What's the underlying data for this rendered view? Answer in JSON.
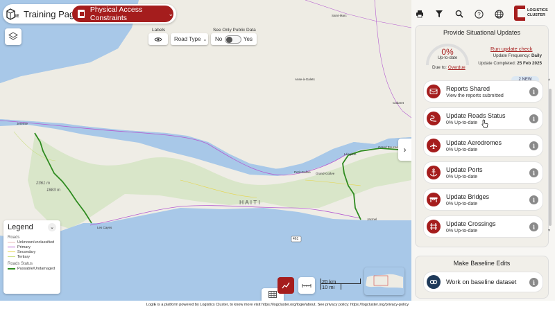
{
  "header": {
    "page_title": "Training Page",
    "context_label": "Physical Access Constraints"
  },
  "map_controls": {
    "labels_title": "Labels",
    "road_type_label": "Road Type",
    "public_data_title": "See Only Public Data",
    "public_no": "No",
    "public_yes": "Yes"
  },
  "map_labels": {
    "haiti": "HAITI",
    "elev_1": "2361 m",
    "elev_2": "1883 m",
    "route_number": "461",
    "towns": [
      "Jeremie",
      "Les Cayes",
      "Jacmel",
      "Saint-Marc",
      "Anse-à-Galets",
      "Cabaret",
      "Petit-Goâve",
      "Grand-Goâve",
      "Léogâne",
      "Grand Boucan"
    ]
  },
  "legend": {
    "title": "Legend",
    "roads_title": "Roads",
    "roads": [
      {
        "label": "Unknown/unclassified",
        "color": "#e8b6b6"
      },
      {
        "label": "Primary",
        "color": "#b45bd0"
      },
      {
        "label": "Secondary",
        "color": "#e6d54a"
      },
      {
        "label": "Tertiary",
        "color": "#c8dc7a"
      }
    ],
    "status_title": "Roads Status",
    "status": [
      {
        "label": "Passable/Undamaged",
        "color": "#2e8b1f"
      }
    ]
  },
  "scale": {
    "top": "20 km",
    "bottom": "10 mi"
  },
  "footer": "LogIE is a platform powered by Logistics Cluster, to know more visit https://logcluster.org/logie/about. See privacy policy: https://logcluster.org/privacy-policy",
  "brand": {
    "line1": "LOGISTICS",
    "line2": "CLUSTER"
  },
  "updates": {
    "title": "Provide Situational Updates",
    "percent": "0%",
    "status": "Up-to-date",
    "due_label": "Due to:",
    "due_value": "Overdue",
    "run_check": "Run update check",
    "frequency_label": "Update Frequency:",
    "frequency_value": "Daily",
    "completed_label": "Update Completed:",
    "completed_value": "25 Feb 2025",
    "new_badge": "2 NEW",
    "items": [
      {
        "title": "Reports Shared",
        "sub": "View the reports submitted",
        "icon": "reports-icon"
      },
      {
        "title": "Update Roads Status",
        "sub": "0% Up-to-date",
        "icon": "road-icon"
      },
      {
        "title": "Update Aerodromes",
        "sub": "0% Up-to-date",
        "icon": "airplane-icon"
      },
      {
        "title": "Update Ports",
        "sub": "0% Up-to-date",
        "icon": "anchor-icon"
      },
      {
        "title": "Update Bridges",
        "sub": "0% Up-to-date",
        "icon": "bridge-icon"
      },
      {
        "title": "Update Crossings",
        "sub": "0% Up-to-date",
        "icon": "crossing-icon"
      }
    ]
  },
  "baseline": {
    "title": "Make Baseline Edits",
    "item": "Work on baseline dataset"
  },
  "colors": {
    "accent": "#a51d1d",
    "sea": "#a8c8e8",
    "land": "#f1efe9"
  }
}
